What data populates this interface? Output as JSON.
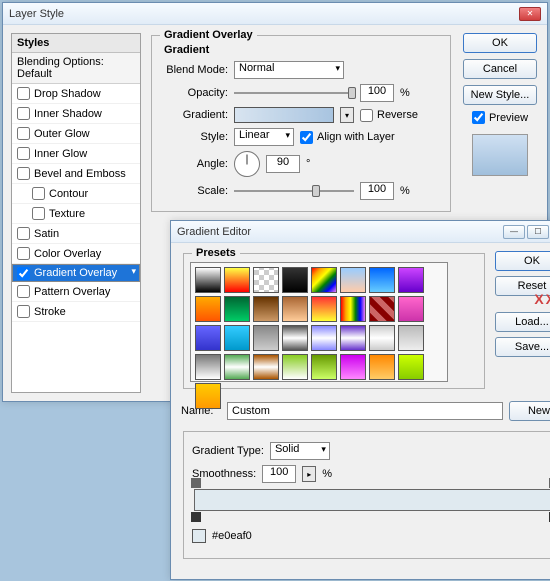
{
  "layerStyle": {
    "title": "Layer Style",
    "stylesHeader": "Styles",
    "blendingOptions": "Blending Options: Default",
    "items": [
      {
        "label": "Drop Shadow",
        "checked": false
      },
      {
        "label": "Inner Shadow",
        "checked": false
      },
      {
        "label": "Outer Glow",
        "checked": false
      },
      {
        "label": "Inner Glow",
        "checked": false
      },
      {
        "label": "Bevel and Emboss",
        "checked": false
      },
      {
        "label": "Contour",
        "checked": false,
        "indent": true
      },
      {
        "label": "Texture",
        "checked": false,
        "indent": true
      },
      {
        "label": "Satin",
        "checked": false
      },
      {
        "label": "Color Overlay",
        "checked": false
      },
      {
        "label": "Gradient Overlay",
        "checked": true,
        "selected": true
      },
      {
        "label": "Pattern Overlay",
        "checked": false
      },
      {
        "label": "Stroke",
        "checked": false
      }
    ],
    "group": {
      "title": "Gradient Overlay",
      "subtitle": "Gradient",
      "blendModeLabel": "Blend Mode:",
      "blendMode": "Normal",
      "opacityLabel": "Opacity:",
      "opacity": "100",
      "pct": "%",
      "gradientLabel": "Gradient:",
      "reverse": "Reverse",
      "styleLabel": "Style:",
      "style": "Linear",
      "align": "Align with Layer",
      "angleLabel": "Angle:",
      "angle": "90",
      "deg": "°",
      "scaleLabel": "Scale:",
      "scale": "100"
    },
    "buttons": {
      "ok": "OK",
      "cancel": "Cancel",
      "newStyle": "New Style...",
      "preview": "Preview"
    }
  },
  "gradEditor": {
    "title": "Gradient Editor",
    "presetsLabel": "Presets",
    "swatches": [
      "linear-gradient(#fff,#000)",
      "linear-gradient(#ff4,#f00)",
      "repeating-conic-gradient(#ccc 0 25%,#fff 0 50%) 0/10px 10px",
      "linear-gradient(#333,#000)",
      "linear-gradient(135deg,red,orange,yellow,green,blue,violet)",
      "linear-gradient(#9cf,#fca)",
      "linear-gradient(#06f,#6cf)",
      "linear-gradient(#c4f,#60c)",
      "linear-gradient(#fa0,#f50)",
      "linear-gradient(#063,#0c6)",
      "linear-gradient(#630,#c96)",
      "linear-gradient(#a63,#fc9)",
      "linear-gradient(#f33,#ff3)",
      "linear-gradient(90deg,red,orange,yellow,green,blue,violet)",
      "repeating-linear-gradient(45deg,#800 0 6px,#c66 0 12px)",
      "linear-gradient(#f6c,#c3a)",
      "linear-gradient(#66f,#33c)",
      "linear-gradient(#3cf,#09c)",
      "linear-gradient(#888,#ccc)",
      "linear-gradient(#555,#fff,#555)",
      "linear-gradient(#88f,#fff,#88f)",
      "linear-gradient(#63c,#fff,#63c)",
      "linear-gradient(#ccc,#fff,#ccc)",
      "linear-gradient(#bbb,#eee)",
      "linear-gradient(#777,#fff)",
      "linear-gradient(#5a5,#fff,#5a5)",
      "linear-gradient(#a50,#fff,#a50)",
      "linear-gradient(#8c2,#fff)",
      "linear-gradient(#690,#cf6)",
      "linear-gradient(#c0e,#f8f)",
      "linear-gradient(#f80,#fc6)",
      "linear-gradient(#cf0,#8c0)",
      "linear-gradient(#fc0,#f90)"
    ],
    "buttons": {
      "ok": "OK",
      "reset": "Reset",
      "load": "Load...",
      "save": "Save..."
    },
    "xx": "XX",
    "nameLabel": "Name:",
    "name": "Custom",
    "new": "New",
    "typeLabel": "Gradient Type:",
    "type": "Solid",
    "smoothLabel": "Smoothness:",
    "smooth": "100",
    "pct": "%",
    "color": "#e0eaf0"
  }
}
